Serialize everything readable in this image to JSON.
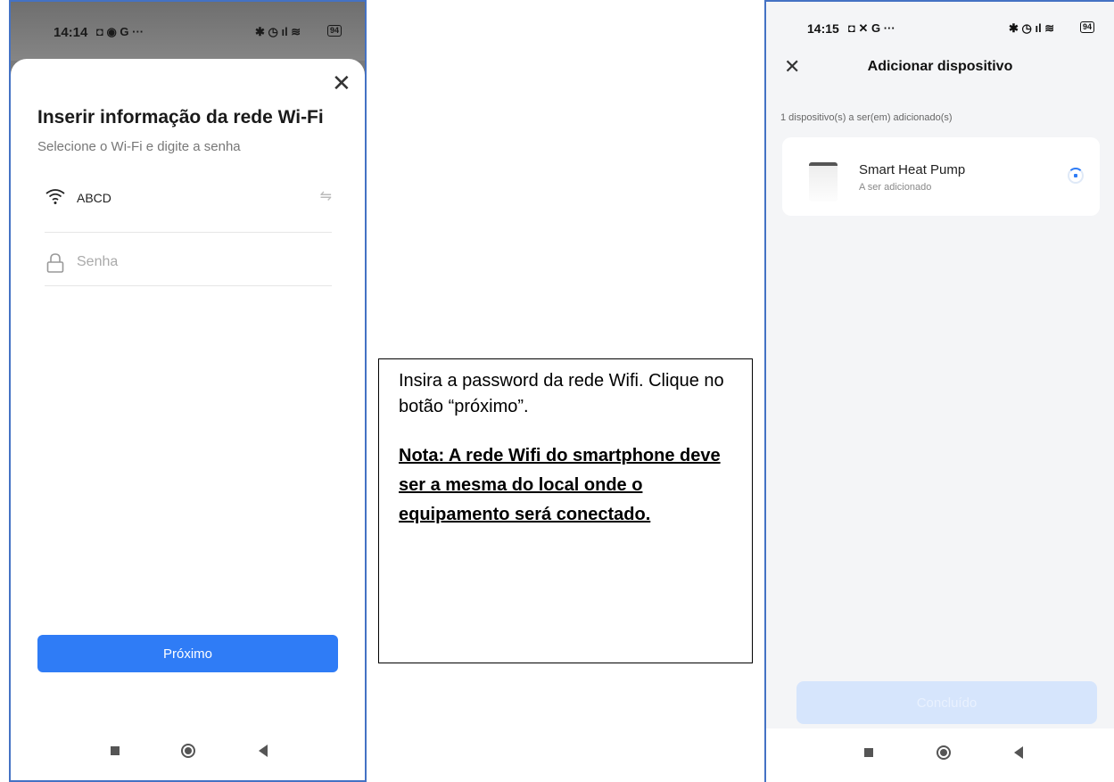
{
  "left_phone": {
    "status": {
      "time": "14:14",
      "icons_left": "◘ ◉ G ···",
      "icons_right": "✱ ◷ ıl ≋",
      "battery": "94"
    },
    "title": "Inserir informação da rede Wi-Fi",
    "subtitle": "Selecione o Wi-Fi e digite a senha",
    "wifi_name": "ABCD",
    "password_placeholder": "Senha",
    "next_label": "Próximo"
  },
  "instruction_box": {
    "line1": "Insira a password da rede Wifi. Clique no botão “próximo”.",
    "note": "Nota: A rede Wifi do smartphone deve ser a mesma do local onde o equipamento será conectado."
  },
  "right_phone": {
    "status": {
      "time": "14:15",
      "icons_left": "◘ ✕ G ···",
      "icons_right": "✱ ◷ ıl ≋",
      "battery": "94"
    },
    "title": "Adicionar dispositivo",
    "count_text": "1 dispositivo(s) a ser(em) adicionado(s)",
    "device": {
      "name": "Smart Heat Pump",
      "status": "A ser adicionado"
    },
    "done_label": "Concluído"
  },
  "icons": {
    "close": "close-icon",
    "wifi": "wifi-icon",
    "swap": "swap-icon",
    "lock": "lock-icon",
    "spinner": "loading-spinner-icon"
  },
  "colors": {
    "primary_blue": "#2f7cf6",
    "disabled_blue": "#d6e5fc",
    "frame_blue": "#4472c4"
  }
}
